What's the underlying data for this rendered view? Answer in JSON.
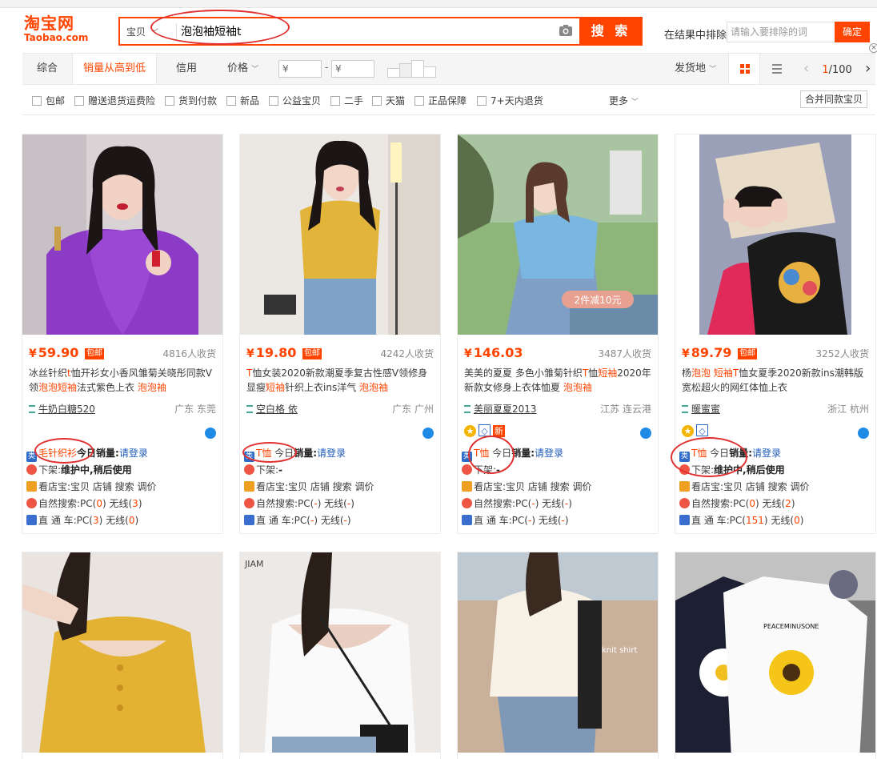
{
  "header": {
    "logo_cn": "淘宝网",
    "logo_en": "Taobao.com",
    "search_scope": "宝贝",
    "search_query": "泡泡袖短袖t",
    "search_button": "搜 索",
    "exclude_label": "在结果中排除",
    "exclude_placeholder": "请输入要排除的词",
    "exclude_button": "确定"
  },
  "sortbar": {
    "items": [
      "综合",
      "销量从高到低",
      "信用",
      "价格"
    ],
    "price_min_placeholder": "¥",
    "price_max_placeholder": "¥",
    "dash": "-",
    "ship_from": "发货地",
    "page_current": "1",
    "page_total": "/100",
    "prev": "‹",
    "next": "›"
  },
  "filters": {
    "items": [
      "包邮",
      "赠送退货运费险",
      "货到付款",
      "新品",
      "公益宝贝",
      "二手",
      "天猫",
      "正品保障",
      "7+天内退货"
    ],
    "more": "更多",
    "merge": "合并同款宝贝"
  },
  "products": [
    {
      "price": "59.90",
      "baoyou": "包邮",
      "sales": "4816人收货",
      "title_parts": [
        "冰丝针织",
        "t",
        "恤开衫女小香风雏菊关晓彤同款V领",
        "泡泡短袖",
        "法式紫色上衣 ",
        "泡泡袖"
      ],
      "shop": "牛奶白糖520",
      "location": "广东 东莞",
      "category": "毛针织衫",
      "category_suffix": "",
      "today_sales_label": "今日销量:",
      "today_sales_value": "请登录",
      "offshelf": "下架:",
      "offshelf_value": "维护中,稍后使用",
      "tools": "看店宝:宝贝 店铺 搜索 调价",
      "natural": "自然搜索:PC(",
      "natural_pc": "0",
      "natural_mid": ") 无线(",
      "natural_wx": "3",
      "natural_end": ")",
      "ztc": "直 通 车:PC(",
      "ztc_pc": "3",
      "ztc_mid": ") 无线(",
      "ztc_wx": "0",
      "ztc_end": ")"
    },
    {
      "price": "19.80",
      "baoyou": "包邮",
      "sales": "4242人收货",
      "title_parts": [
        "T",
        "恤",
        "女装2020新款潮夏季复古性感V领修身显瘦",
        "短袖",
        "针织上衣ins洋气 ",
        "泡泡袖"
      ],
      "shop": "空白格 依",
      "location": "广东 广州",
      "category": "T恤",
      "category_suffix": "今日",
      "today_sales_label": "销量:",
      "today_sales_value": "请登录",
      "offshelf": "下架:",
      "offshelf_value": "-",
      "tools": "看店宝:宝贝 店铺 搜索 调价",
      "natural": "自然搜索:PC(",
      "natural_pc": "-",
      "natural_mid": ") 无线(",
      "natural_wx": "-",
      "natural_end": ")",
      "ztc": "直 通 车:PC(",
      "ztc_pc": "-",
      "ztc_mid": ") 无线(",
      "ztc_wx": "-",
      "ztc_end": ")"
    },
    {
      "price": "146.03",
      "baoyou": "",
      "sales": "3487人收货",
      "title_parts": [
        "美美的夏夏 多色小雏菊针织",
        "T",
        "恤",
        "短袖",
        "2020年新款女修身上衣体恤夏 ",
        "泡泡袖"
      ],
      "shop": "美丽夏夏2013",
      "location": "江苏 连云港",
      "image_badge": "2件减10元",
      "badge_new": "新",
      "category": "T恤",
      "category_suffix": "今日",
      "today_sales_label": "销量:",
      "today_sales_value": "请登录",
      "offshelf": "下架:",
      "offshelf_value": "-",
      "tools": "看店宝:宝贝 店铺 搜索 调价",
      "natural": "自然搜索:PC(",
      "natural_pc": "-",
      "natural_mid": ") 无线(",
      "natural_wx": "-",
      "natural_end": ")",
      "ztc": "直 通 车:PC(",
      "ztc_pc": "-",
      "ztc_mid": ") 无线(",
      "ztc_wx": "-",
      "ztc_end": ")"
    },
    {
      "price": "89.79",
      "baoyou": "包邮",
      "sales": "3252人收货",
      "title_parts": [
        "杨",
        "泡泡 短袖",
        "T",
        "恤女夏季2020新款ins潮韩版宽松超火的网红体恤上衣"
      ],
      "shop": "暖蜜蜜",
      "location": "浙江 杭州",
      "category": "T恤",
      "category_suffix": "今日",
      "today_sales_label": "销量:",
      "today_sales_value": "请登录",
      "offshelf": "下架:",
      "offshelf_value": "维护中,稍后使用",
      "tools": "看店宝:宝贝 店铺 搜索 调价",
      "natural": "自然搜索:PC(",
      "natural_pc": "0",
      "natural_mid": ") 无线(",
      "natural_wx": "2",
      "natural_end": ")",
      "ztc": "直 通 车:PC(",
      "ztc_pc": "151",
      "ztc_mid": ") 无线(",
      "ztc_wx": "0",
      "ztc_end": ")"
    }
  ],
  "second_row_brand": "JIAM",
  "second_row_shirt_text": "PEACEMINUSONE",
  "knit_shirt_text": "knit shirt",
  "colors": {
    "accent": "#ff4400",
    "link_blue": "#1e5bb8",
    "annotation_red": "#e03030"
  }
}
